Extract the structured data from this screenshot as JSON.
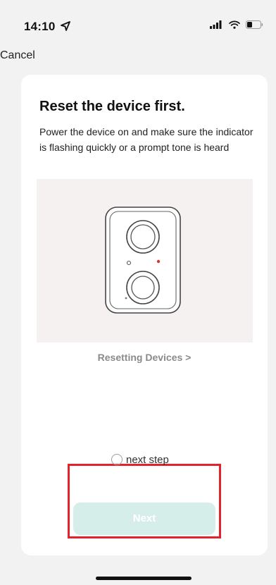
{
  "status": {
    "time": "14:10"
  },
  "nav": {
    "cancel_label": "Cancel"
  },
  "card": {
    "title": "Reset the device first.",
    "description": "Power the device on and make sure the indicator is flashing quickly or a prompt tone is heard",
    "reset_link": "Resetting Devices >"
  },
  "confirm": {
    "radio_label": "next step",
    "checked": false
  },
  "next_button": {
    "label": "Next"
  },
  "colors": {
    "highlight": "#e3232c",
    "button_bg": "#d6eee9",
    "indicator_led": "#e0322d"
  },
  "icons": {
    "status_location": "location-arrow-icon",
    "status_signal": "signal-icon",
    "status_wifi": "wifi-icon",
    "status_battery": "battery-icon"
  }
}
